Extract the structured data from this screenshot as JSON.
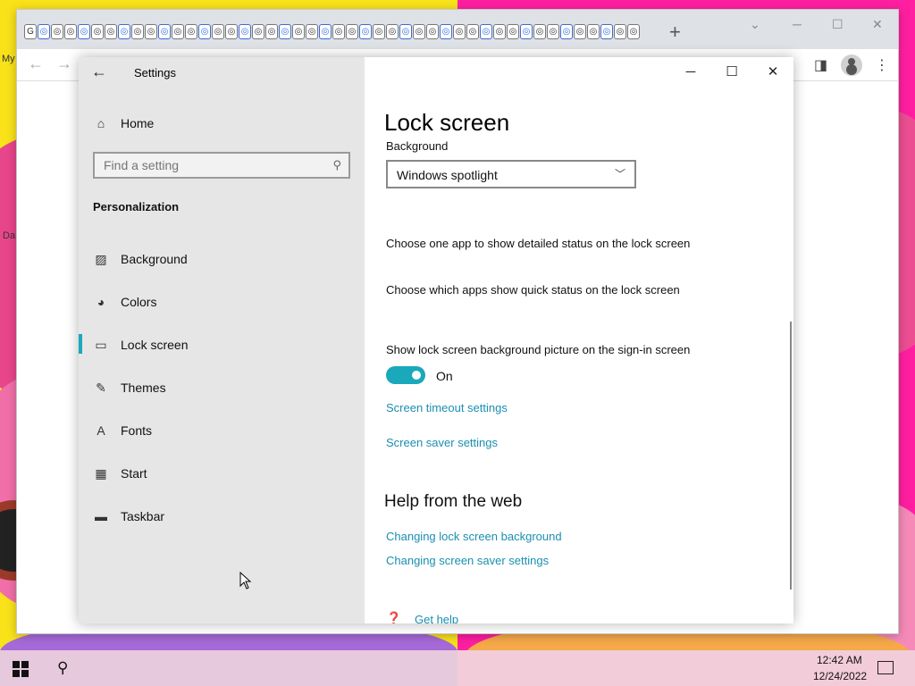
{
  "desktop": {
    "icon_label_1": "My",
    "icon_label_2": "Da"
  },
  "browser": {
    "new_tab_symbol": "+",
    "minimize_symbol": "─",
    "maximize_symbol": "☐",
    "close_symbol": "✕",
    "tab_count": 46
  },
  "settings": {
    "app_title": "Settings",
    "sidebar": {
      "home_label": "Home",
      "search_placeholder": "Find a setting",
      "section_heading": "Personalization",
      "items": [
        {
          "label": "Background",
          "icon": "picture-icon"
        },
        {
          "label": "Colors",
          "icon": "palette-icon"
        },
        {
          "label": "Lock screen",
          "icon": "lock-screen-icon",
          "selected": true
        },
        {
          "label": "Themes",
          "icon": "themes-icon"
        },
        {
          "label": "Fonts",
          "icon": "fonts-icon"
        },
        {
          "label": "Start",
          "icon": "start-icon"
        },
        {
          "label": "Taskbar",
          "icon": "taskbar-icon"
        }
      ]
    },
    "content": {
      "title": "Lock screen",
      "background_label": "Background",
      "background_value": "Windows spotlight",
      "detailed_status_text": "Choose one app to show detailed status on the lock screen",
      "quick_status_text": "Choose which apps show quick status on the lock screen",
      "show_bg_signin_text": "Show lock screen background picture on the sign-in screen",
      "toggle_state": "On",
      "toggle_on": true,
      "screen_timeout_link": "Screen timeout settings",
      "screen_saver_link": "Screen saver settings",
      "help_heading": "Help from the web",
      "help_link_1": "Changing lock screen background",
      "help_link_2": "Changing screen saver settings",
      "get_help_link": "Get help"
    }
  },
  "taskbar": {
    "time": "12:42 AM",
    "date": "12/24/2022"
  },
  "colors": {
    "accent": "#1aa8bb",
    "link": "#1a8fb0",
    "sidebar_bg": "#e6e6e6"
  }
}
